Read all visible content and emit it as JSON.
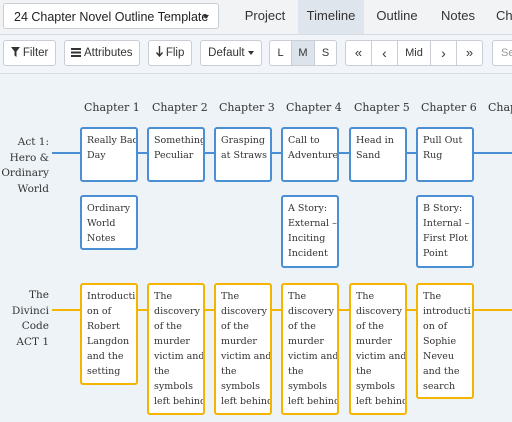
{
  "project": {
    "title": "24 Chapter Novel Outline Template"
  },
  "tabs": [
    {
      "label": "Project"
    },
    {
      "label": "Timeline"
    },
    {
      "label": "Outline"
    },
    {
      "label": "Notes"
    },
    {
      "label": "Ch"
    }
  ],
  "active_tab": "Timeline",
  "toolbar": {
    "filter_label": "Filter",
    "attributes_label": "Attributes",
    "flip_label": "Flip",
    "default_label": "Default",
    "size_options": [
      "L",
      "M",
      "S"
    ],
    "selected_size": "M",
    "nav_first": "«",
    "nav_prev": "‹",
    "nav_mid": "Mid",
    "nav_next": "›",
    "nav_last": "»",
    "search_placeholder": "Se"
  },
  "chapters": [
    "Chapter 1",
    "Chapter 2",
    "Chapter 3",
    "Chapter 4",
    "Chapter 5",
    "Chapter 6",
    "Chap"
  ],
  "rows": [
    {
      "label": "Act 1:\nHero &\nOrdinary\nWorld",
      "color": "#4a8ed4",
      "cards": [
        "Really Bad\nDay",
        "Something\nPeculiar",
        "Grasping\nat Straws",
        "Call to\nAdventure",
        "Head in\nSand",
        "Pull Out\nRug"
      ],
      "subcards": [
        "Ordinary\nWorld\nNotes",
        "A Story:\nExternal –\nInciting\nIncident",
        "B Story:\nInternal –\nFirst Plot\nPoint"
      ]
    },
    {
      "label": "The\nDivinci\nCode\nACT 1",
      "color": "#f4b400",
      "cards": [
        "Introducti\non of\nRobert\nLangdon\nand the\nsetting",
        "The\ndiscovery\nof the\nmurder\nvictim and\nthe\nsymbols\nleft behind",
        "The\ndiscovery\nof the\nmurder\nvictim and\nthe\nsymbols\nleft behind",
        "The\ndiscovery\nof the\nmurder\nvictim and\nthe\nsymbols\nleft behind",
        "The\ndiscovery\nof the\nmurder\nvictim and\nthe\nsymbols\nleft behind",
        "The\nintroducti\non of\nSophie\nNeveu\nand the\nsearch\nfor clues"
      ]
    }
  ]
}
